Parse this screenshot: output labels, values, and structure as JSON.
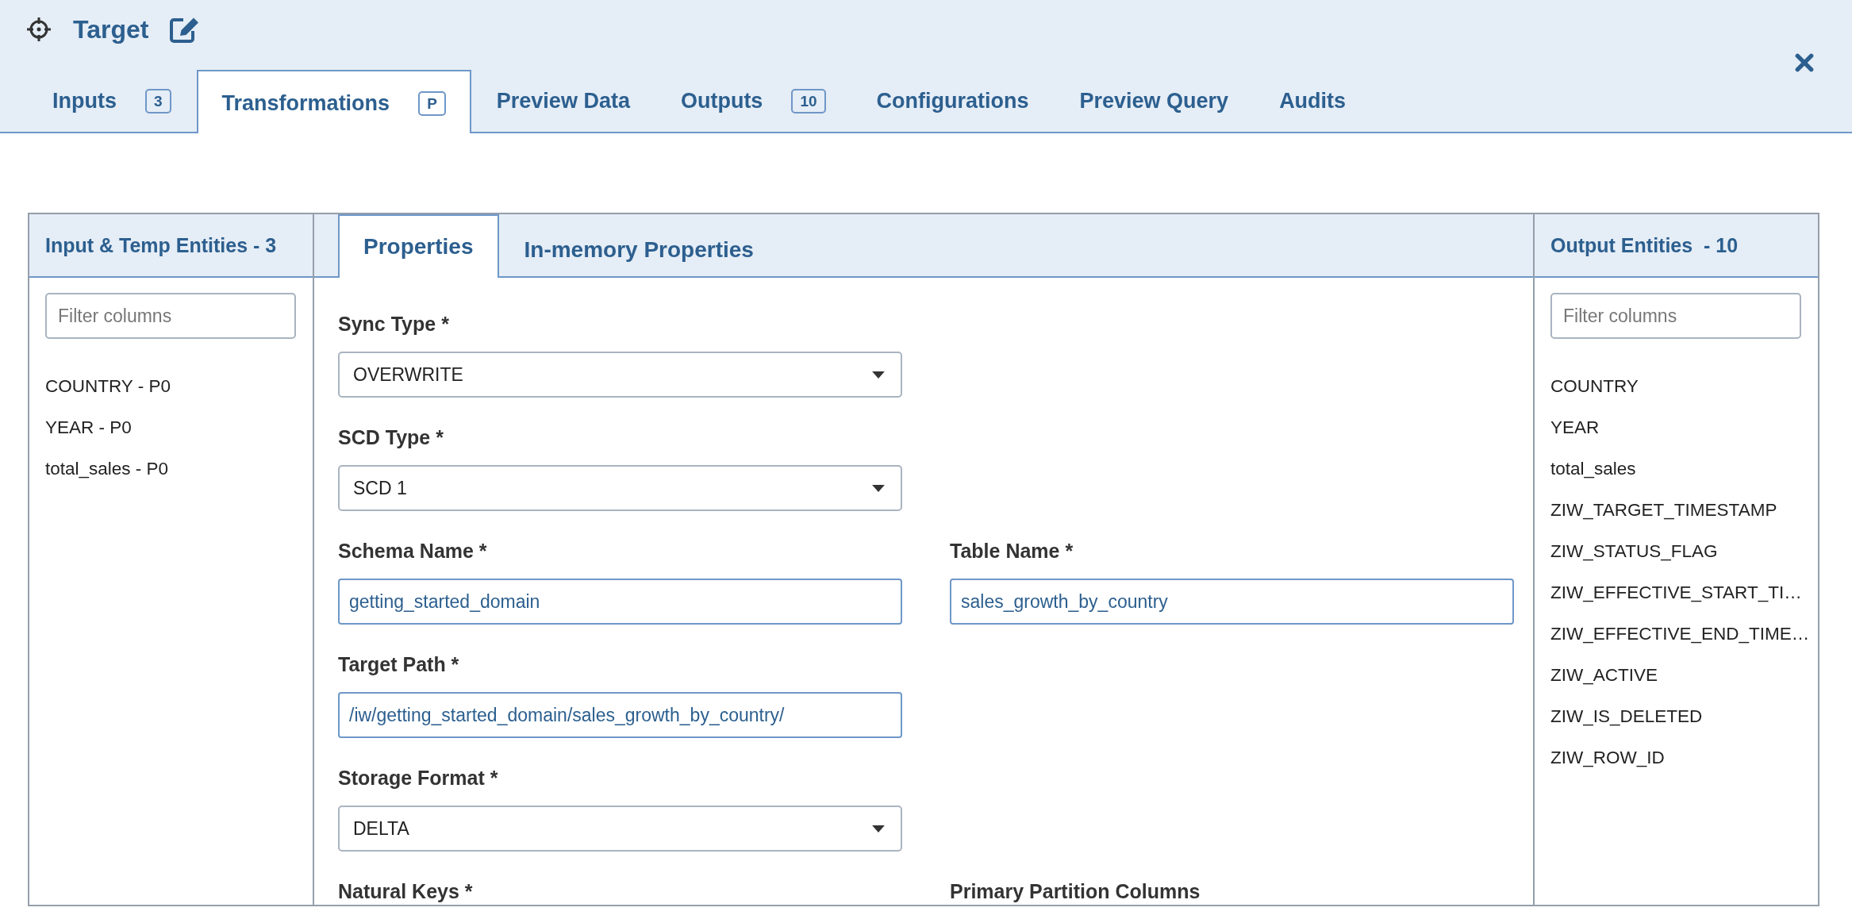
{
  "header": {
    "title": "Target"
  },
  "tabs": [
    {
      "label": "Inputs",
      "badge": "3",
      "selected": false
    },
    {
      "label": "Transformations",
      "badge": "P",
      "selected": true
    },
    {
      "label": "Preview Data",
      "selected": false
    },
    {
      "label": "Outputs",
      "badge": "10",
      "selected": false
    },
    {
      "label": "Configurations",
      "selected": false
    },
    {
      "label": "Preview Query",
      "selected": false
    },
    {
      "label": "Audits",
      "selected": false
    }
  ],
  "input_panel": {
    "title": "Input & Temp Entities - 3",
    "filter": {
      "placeholder": "Filter columns"
    },
    "items": [
      "COUNTRY - P0",
      "YEAR - P0",
      "total_sales - P0"
    ]
  },
  "center_panel": {
    "subtabs": [
      {
        "label": "Properties",
        "selected": true
      },
      {
        "label": "In-memory Properties",
        "selected": false
      }
    ],
    "rows": [
      [
        {
          "kind": "select",
          "label": "Sync Type *",
          "value": "OVERWRITE"
        }
      ],
      [
        {
          "kind": "select",
          "label": "SCD Type *",
          "value": "SCD 1"
        }
      ],
      [
        {
          "kind": "text",
          "label": "Schema Name *",
          "value": "getting_started_domain"
        },
        {
          "kind": "text",
          "label": "Table Name *",
          "value": "sales_growth_by_country"
        }
      ],
      [
        {
          "kind": "text",
          "label": "Target Path *",
          "value": "/iw/getting_started_domain/sales_growth_by_country/"
        }
      ],
      [
        {
          "kind": "select",
          "label": "Storage Format *",
          "value": "DELTA"
        }
      ],
      [
        {
          "kind": "label",
          "label": "Natural Keys *"
        },
        {
          "kind": "label",
          "label": "Primary Partition Columns"
        }
      ]
    ]
  },
  "output_panel": {
    "title": "Output Entities  - 10",
    "filter": {
      "placeholder": "Filter columns"
    },
    "items": [
      "COUNTRY",
      "YEAR",
      "total_sales",
      "ZIW_TARGET_TIMESTAMP",
      "ZIW_STATUS_FLAG",
      "ZIW_EFFECTIVE_START_TI…",
      "ZIW_EFFECTIVE_END_TIME…",
      "ZIW_ACTIVE",
      "ZIW_IS_DELETED",
      "ZIW_ROW_ID"
    ]
  }
}
